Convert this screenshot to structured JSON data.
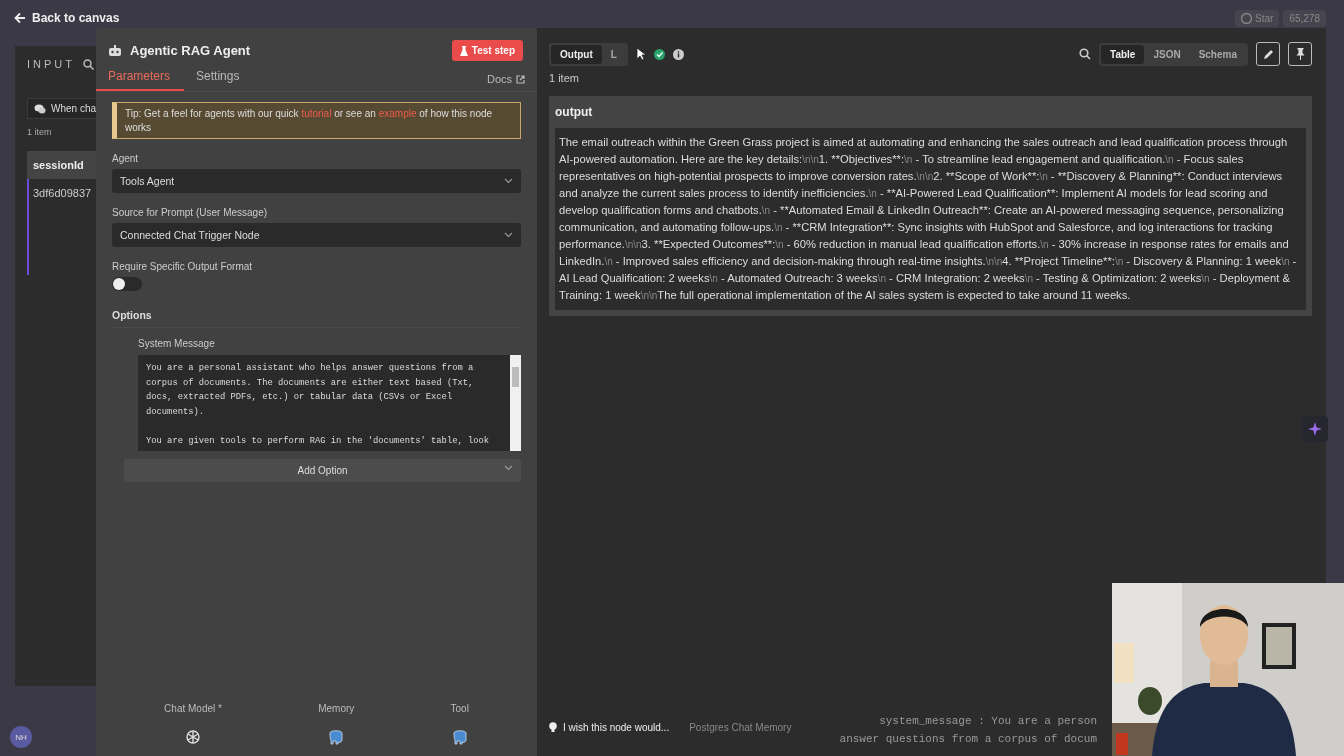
{
  "top_bar": {
    "back_link": "Back to canvas",
    "star_button": "Star",
    "star_count": "65,278"
  },
  "input_panel": {
    "title": "INPUT",
    "trigger_chip": "When cha",
    "item_count": "1 item",
    "column_header": "sessionId",
    "cell": "3df6d09837"
  },
  "node_panel": {
    "title": "Agentic RAG Agent",
    "test_button": "Test step",
    "tabs": [
      {
        "label": "Parameters",
        "selected": true
      },
      {
        "label": "Settings",
        "selected": false
      }
    ],
    "docs_link": "Docs",
    "tip": [
      {
        "kind": "text",
        "text": "Tip: Get a feel for agents with our quick "
      },
      {
        "kind": "link",
        "text": "tutorial"
      },
      {
        "kind": "text",
        "text": " or see an "
      },
      {
        "kind": "link",
        "text": "example"
      },
      {
        "kind": "text",
        "text": " of how this node works"
      }
    ],
    "fields": [
      {
        "kind": "select",
        "label": "Agent",
        "value": "Tools Agent"
      },
      {
        "kind": "select",
        "label": "Source for Prompt (User Message)",
        "value": "Connected Chat Trigger Node"
      },
      {
        "kind": "toggle",
        "label": "Require Specific Output Format",
        "on": false
      }
    ],
    "options": {
      "label": "Options",
      "system_message_label": "System Message",
      "system_message": "You are a personal assistant who helps answer questions from a corpus of documents. The documents are either text based (Txt, docs, extracted PDFs, etc.) or tabular data (CSVs or Excel documents).\n\nYou are given tools to perform RAG in the 'documents' table, look",
      "add_button": "Add Option"
    },
    "connectors": [
      {
        "label": "Chat Model *",
        "kind": "model"
      },
      {
        "label": "Memory",
        "kind": "database"
      },
      {
        "label": "Tool",
        "kind": "database"
      }
    ]
  },
  "output_panel": {
    "tabs": [
      {
        "label": "Output",
        "selected": true
      },
      {
        "label": "L",
        "selected": false
      }
    ],
    "view_modes": [
      {
        "label": "Table",
        "selected": true
      },
      {
        "label": "JSON",
        "selected": false
      },
      {
        "label": "Schema",
        "selected": false
      }
    ],
    "item_count": "1 item",
    "column": "output",
    "value": "The email outreach within the Green Grass project is aimed at automating and enhancing the sales outreach and lead qualification process through AI-powered automation. Here are the key details:\\n\\n1. **Objectives**:\\n   - To streamline lead engagement and qualification.\\n   - Focus sales representatives on high-potential prospects to improve conversion rates.\\n\\n2. **Scope of Work**:\\n   - **Discovery & Planning**: Conduct interviews and analyze the current sales process to identify inefficiencies.\\n   - **AI-Powered Lead Qualification**: Implement AI models for lead scoring and develop qualification forms and chatbots.\\n   - **Automated Email & LinkedIn Outreach**: Create an AI-powered messaging sequence, personalizing communication, and automating follow-ups.\\n   - **CRM Integration**: Sync insights with HubSpot and Salesforce, and log interactions for tracking performance.\\n\\n3. **Expected Outcomes**:\\n   - 60% reduction in manual lead qualification efforts.\\n   - 30% increase in response rates for emails and LinkedIn.\\n   - Improved sales efficiency and decision-making through real-time insights.\\n\\n4. **Project Timeline**:\\n   - Discovery & Planning: 1 week\\n   - AI Lead Qualification: 2 weeks\\n   - Automated Outreach: 3 weeks\\n   - CRM Integration: 2 weeks\\n   - Testing & Optimization: 2 weeks\\n   - Deployment & Training: 1 week\\n\\nThe full operational implementation of the AI sales system is expected to take around 11 weeks.",
    "hint": "I wish this node would...",
    "memory_label": "Postgres Chat Memory",
    "code_lines": [
      "system_message :  You are a person",
      "answer questions from a corpus of docum"
    ]
  },
  "user": {
    "initials": "NH"
  }
}
